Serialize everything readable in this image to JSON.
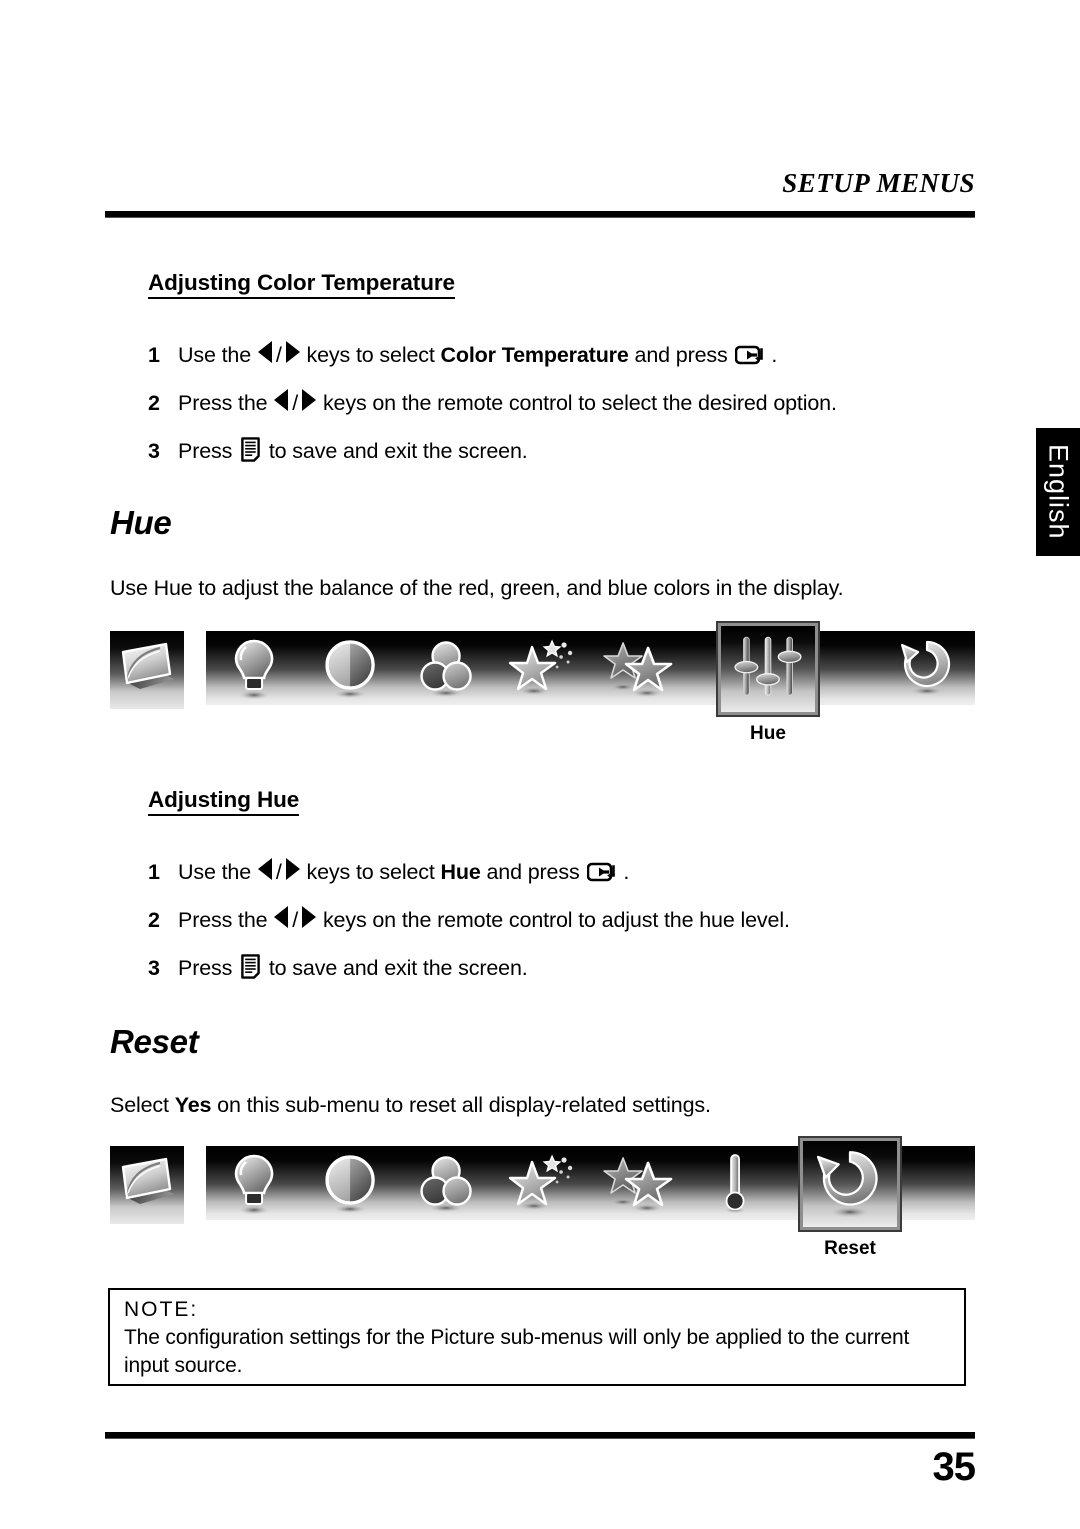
{
  "header": {
    "title": "SETUP MENUS"
  },
  "language_tab": {
    "label": "English"
  },
  "sections": {
    "color_temperature": {
      "heading": "Adjusting Color Temperature",
      "steps": [
        {
          "num": "1",
          "pre": "Use the ",
          "mid": " keys to select ",
          "bold": "Color Temperature",
          "post": " and press ",
          "end": "."
        },
        {
          "num": "2",
          "pre": "Press the ",
          "mid": " keys on the remote control to select the desired option."
        },
        {
          "num": "3",
          "pre": "Press ",
          "post": " to save and exit the screen."
        }
      ]
    },
    "hue": {
      "heading": "Hue",
      "description": "Use Hue to adjust the balance of the red, green, and blue colors in the display.",
      "sub_heading": "Adjusting Hue",
      "steps": [
        {
          "num": "1",
          "pre": "Use the ",
          "mid": " keys to select ",
          "bold": "Hue",
          "post": " and press ",
          "end": "."
        },
        {
          "num": "2",
          "pre": "Press the ",
          "mid": " keys on the remote control to adjust the hue level."
        },
        {
          "num": "3",
          "pre": "Press ",
          "post": " to save and exit the screen."
        }
      ]
    },
    "reset": {
      "heading": "Reset",
      "description_pre": "Select ",
      "description_bold": "Yes",
      "description_post": " on this sub-menu to reset all display-related settings."
    }
  },
  "osd_menu": {
    "icons": [
      {
        "name": "brightness",
        "glyph": "light-bulb"
      },
      {
        "name": "contrast",
        "glyph": "half-circle"
      },
      {
        "name": "color",
        "glyph": "three-circles"
      },
      {
        "name": "sharpness",
        "glyph": "star-sparkle"
      },
      {
        "name": "picture-mode",
        "glyph": "two-stars"
      },
      {
        "name": "color-temperature",
        "glyph": "thermometer"
      },
      {
        "name": "hue",
        "glyph": "sliders"
      },
      {
        "name": "reset",
        "glyph": "circular-arrow"
      }
    ],
    "hue_bar": {
      "selected": "hue",
      "selected_label": "Hue"
    },
    "reset_bar": {
      "selected": "reset",
      "selected_label": "Reset"
    }
  },
  "note": {
    "title": "NOTE:",
    "body": "The configuration settings for the Picture sub-menus will only be applied to the current input source."
  },
  "footer": {
    "page_number": "35"
  }
}
